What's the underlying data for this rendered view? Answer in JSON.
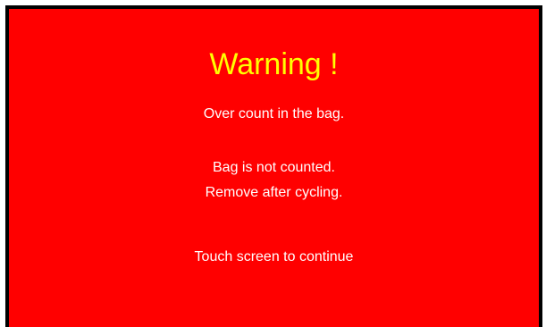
{
  "dialog": {
    "title": "Warning !",
    "messages": [
      "Over count in the bag.",
      "Bag is not counted.",
      "Remove after cycling."
    ],
    "prompt": "Touch screen to continue"
  },
  "colors": {
    "background": "#ff0000",
    "title": "#ffff00",
    "text": "#ffffff",
    "border": "#000000"
  }
}
